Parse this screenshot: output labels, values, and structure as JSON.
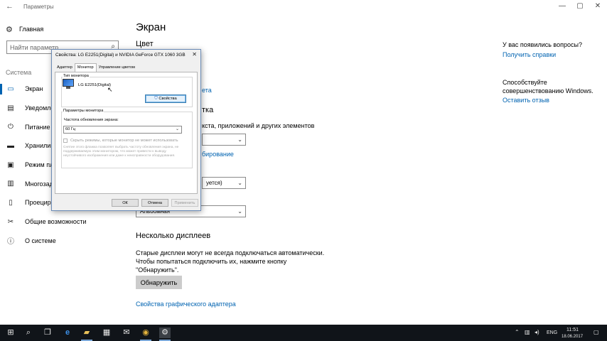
{
  "window": {
    "title": "Параметры",
    "back_icon": "←",
    "minimize_icon": "—",
    "maximize_icon": "▢",
    "close_icon": "✕"
  },
  "sidebar": {
    "home_label": "Главная",
    "home_icon": "⚙",
    "search_placeholder": "Найти параметр",
    "search_icon": "⌕",
    "section_label": "Система",
    "items": [
      {
        "label": "Экран",
        "icon": "▭",
        "active": true
      },
      {
        "label": "Уведомления",
        "icon": "▤"
      },
      {
        "label": "Питание и спящий",
        "icon": "⏻"
      },
      {
        "label": "Хранилище",
        "icon": "▬"
      },
      {
        "label": "Режим планшета",
        "icon": "▣"
      },
      {
        "label": "Многозадачность",
        "icon": "▥"
      },
      {
        "label": "Проецирование",
        "icon": "▯"
      },
      {
        "label": "Общие возможности",
        "icon": "✂"
      },
      {
        "label": "О системе",
        "icon": "ⓘ"
      }
    ]
  },
  "main": {
    "page_title": "Экран",
    "color_heading": "Цвет",
    "peek_link_1": "ета",
    "peek_heading": "тка",
    "peek_text": "кста, приложений и других элементов",
    "peek_link_2": "бирование",
    "dropdown_1_value": "",
    "dropdown_2_value": "уется)",
    "dropdown_3_value": "Альбомная",
    "multi_heading": "Несколько дисплеев",
    "multi_desc_line1": "Старые дисплеи могут не всегда подключаться автоматически.",
    "multi_desc_line2": "Чтобы попытаться подключить их, нажмите кнопку",
    "multi_desc_line3": "\"Обнаружить\".",
    "detect_button": "Обнаружить",
    "adapter_link": "Свойства графического адаптера"
  },
  "right": {
    "question": "У вас появились вопросы?",
    "help_link": "Получить справки",
    "improve_text": "Способствуйте совершенствованию Windows.",
    "feedback_link": "Оставить отзыв"
  },
  "dialog": {
    "title": "Свойства: LG E2251(Digital) и NVIDIA GeForce GTX 1060 3GB",
    "close_icon": "✕",
    "tabs": [
      "Адаптер",
      "Монитор",
      "Управление цветом"
    ],
    "monitor_type_group": "Тип монитора",
    "monitor_name": "LG E2251(Digital)",
    "properties_button": "Свойства",
    "properties_shield_icon": "⛉",
    "monitor_settings_group": "Параметры монитора",
    "refresh_rate_label": "Частота обновления экрана:",
    "refresh_rate_value": "60 Гц",
    "refresh_chevron": "⌄",
    "hide_modes_label": "Скрыть режимы, которые монитор не может использовать",
    "hint_text": "Снятие этого флажка позволяет выбрать частоту обновления экрана, не поддерживаемую этим монитором, что может привести к выводу неустойчивого изображения или даже к неисправности оборудования.",
    "ok_button": "ОК",
    "cancel_button": "Отмена",
    "apply_button": "Применить"
  },
  "taskbar": {
    "start_icon": "⊞",
    "search_icon": "⌕",
    "taskview_icon": "❐",
    "edge_icon": "e",
    "explorer_icon": "▰",
    "store_icon": "▦",
    "mail_icon": "✉",
    "chrome_icon": "◉",
    "settings_icon": "⚙",
    "tray_chevron": "⌃",
    "tray_network": "▥",
    "tray_volume": "◂)",
    "language": "ENG",
    "notification_icon": "▢",
    "time": "11:51",
    "date": "18.06.2017"
  },
  "colors": {
    "accent": "#0063b1",
    "taskbar": "#101419",
    "dialog_bg": "#f0f0f0"
  }
}
